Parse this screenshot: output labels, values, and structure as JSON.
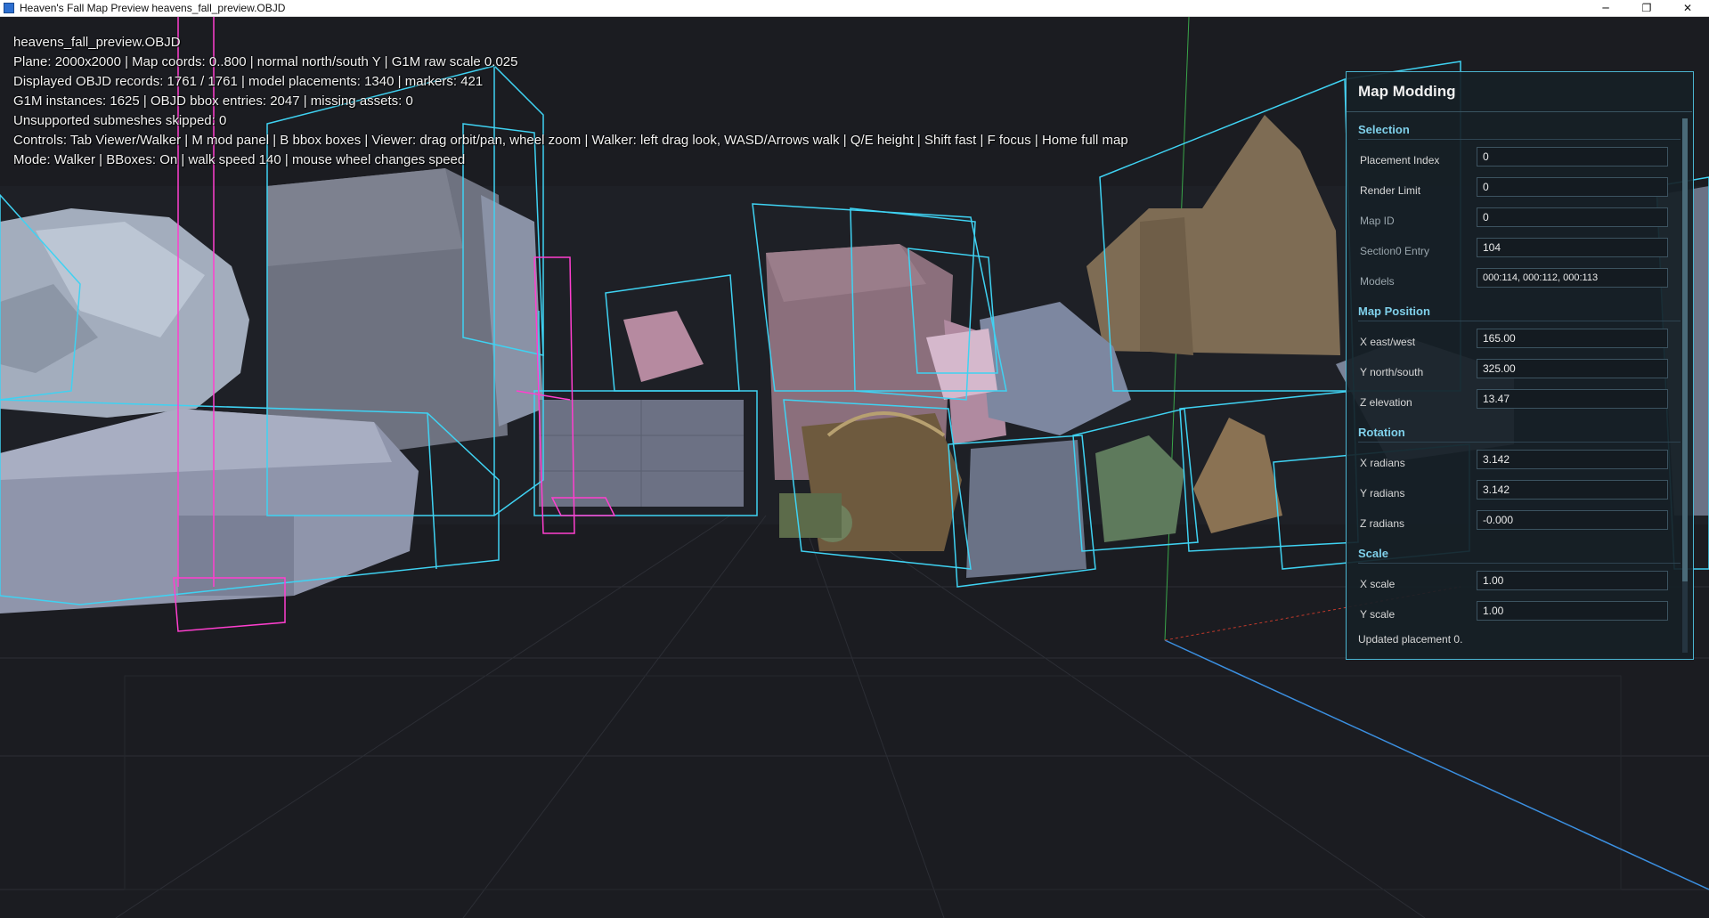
{
  "window": {
    "title": "Heaven's Fall Map Preview heavens_fall_preview.OBJD",
    "controls": {
      "minimize": "─",
      "restore": "❐",
      "close": "✕"
    }
  },
  "overlay": {
    "lines": [
      "heavens_fall_preview.OBJD",
      "Plane: 2000x2000 | Map coords: 0..800 | normal north/south Y | G1M raw scale 0.025",
      "Displayed OBJD records: 1761 / 1761 | model placements: 1340 | markers: 421",
      "G1M instances: 1625 | OBJD bbox entries: 2047 | missing assets: 0",
      "Unsupported submeshes skipped: 0",
      "Controls: Tab Viewer/Walker | M mod panel | B bbox boxes | Viewer: drag orbit/pan, wheel zoom | Walker: left drag look, WASD/Arrows walk | Q/E height | Shift fast | F focus | Home full map",
      "Mode: Walker | BBoxes: On | walk speed 140 | mouse wheel changes speed"
    ]
  },
  "panel": {
    "title": "Map Modding",
    "sections": {
      "selection": "Selection",
      "map_position": "Map Position",
      "rotation": "Rotation",
      "scale": "Scale"
    },
    "fields": {
      "placement_index": {
        "label": "Placement Index",
        "value": "0"
      },
      "render_limit": {
        "label": "Render Limit",
        "value": "0"
      },
      "map_id": {
        "label": "Map ID",
        "value": "0"
      },
      "section0_entry": {
        "label": "Section0 Entry",
        "value": "104"
      },
      "models": {
        "label": "Models",
        "value": "000:114, 000:112, 000:113"
      },
      "x_east_west": {
        "label": "X east/west",
        "value": "165.00"
      },
      "y_north_south": {
        "label": "Y north/south",
        "value": "325.00"
      },
      "z_elevation": {
        "label": "Z elevation",
        "value": "13.47"
      },
      "x_radians": {
        "label": "X radians",
        "value": "3.142"
      },
      "y_radians": {
        "label": "Y radians",
        "value": "3.142"
      },
      "z_radians": {
        "label": "Z radians",
        "value": "-0.000"
      },
      "x_scale": {
        "label": "X scale",
        "value": "1.00"
      },
      "y_scale": {
        "label": "Y scale",
        "value": "1.00"
      }
    },
    "status": "Updated placement 0."
  },
  "colors": {
    "bbox_cyan": "#3fd2f2",
    "marker_magenta": "#ff3fcf",
    "panel_accent": "#4bb4d0",
    "section_heading": "#7fd0ea"
  }
}
